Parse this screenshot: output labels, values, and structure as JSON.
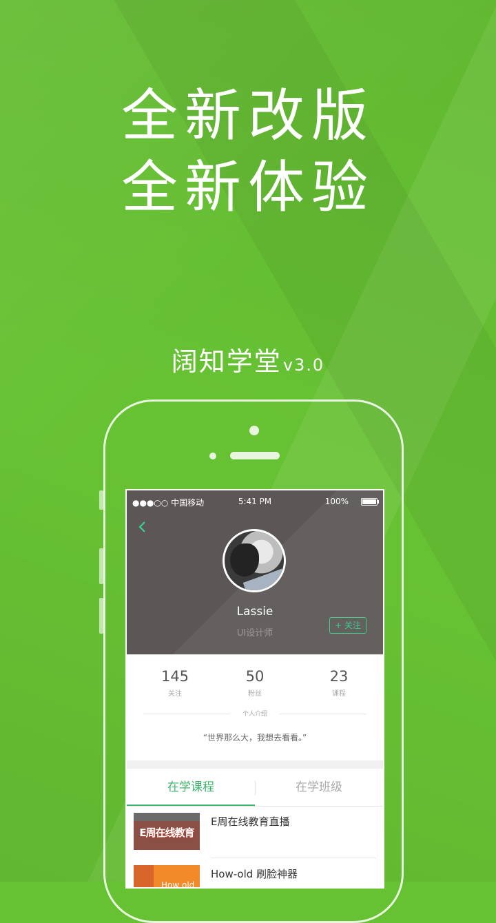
{
  "colors": {
    "background": "#67c233",
    "accent": "#3ecf8e",
    "tab_active": "#3db56c",
    "profile_bg": "#5c5756"
  },
  "headline": {
    "line1": "全新改版",
    "line2": "全新体验"
  },
  "app": {
    "name": "阔知学堂",
    "version": "v3.0"
  },
  "status_bar": {
    "carrier": "●●●○○ 中国移动",
    "time": "5:41 PM",
    "battery": "100%"
  },
  "profile": {
    "name": "Lassie",
    "role": "UI设计师",
    "follow_label": "+ 关注",
    "back_icon": "chevron-left-icon"
  },
  "stats": [
    {
      "value": "145",
      "label": "关注"
    },
    {
      "value": "50",
      "label": "粉丝"
    },
    {
      "value": "23",
      "label": "课程"
    }
  ],
  "intro": {
    "title": "个人介绍",
    "quote": "“世界那么大，我想去看看。”"
  },
  "tabs": [
    {
      "label": "在学课程",
      "active": true
    },
    {
      "label": "在学班级",
      "active": false
    }
  ],
  "courses": [
    {
      "title": "E周在线教育直播",
      "thumb_text": "E周在线教育"
    },
    {
      "title": "How-old 刷脸神器",
      "thumb_text": "How old"
    }
  ]
}
